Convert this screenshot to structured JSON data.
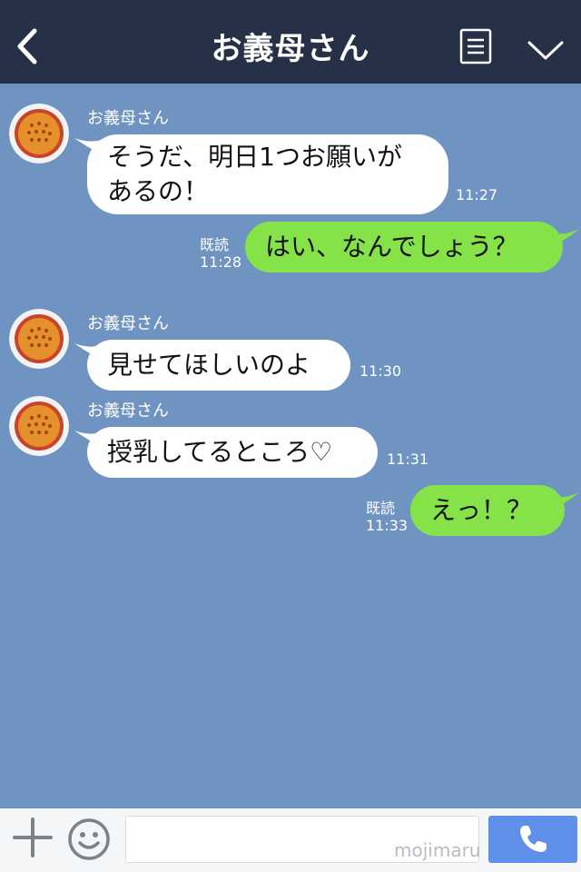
{
  "header": {
    "title": "お義母さん"
  },
  "messages": [
    {
      "sender": "お義母さん",
      "lines": [
        "そうだ、明日1つお願いが",
        "あるの！"
      ],
      "time": "11:27"
    },
    {
      "read": "既読",
      "time": "11:28",
      "text": "はい、なんでしょう？"
    },
    {
      "sender": "お義母さん",
      "text": "見せてほしいのよ",
      "time": "11:30"
    },
    {
      "sender": "お義母さん",
      "text": "授乳してるところ♡",
      "time": "11:31"
    },
    {
      "read": "既読",
      "time": "11:33",
      "text": "えっ！？"
    }
  ],
  "composer": {
    "watermark": "mojimaru"
  },
  "colors": {
    "header": "#263047",
    "chat_bg": "#7094c2",
    "outgoing": "#85e249",
    "incoming": "#ffffff",
    "send": "#5f8fe8"
  },
  "icons": [
    "back-icon",
    "menu-icon",
    "chevron-down-icon",
    "plus-icon",
    "emoji-icon",
    "phone-icon"
  ]
}
